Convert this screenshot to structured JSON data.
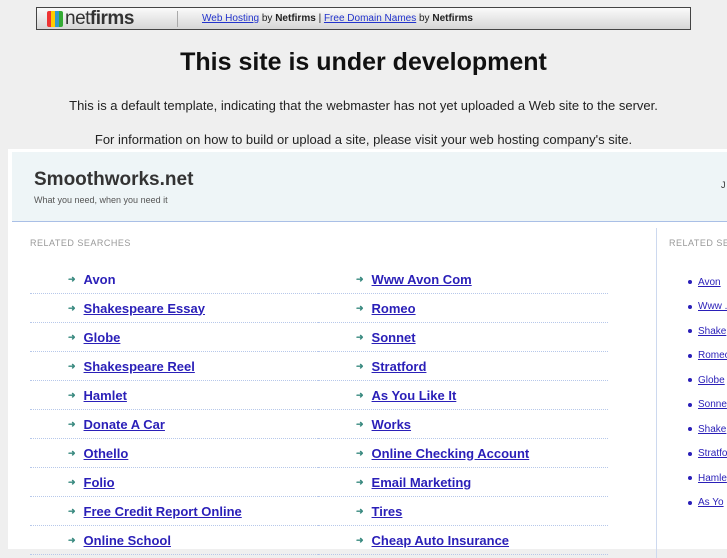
{
  "topbar": {
    "logo_text_light": "net",
    "logo_text_bold": "firms",
    "link1": "Web Hosting",
    "by1": "by",
    "brand1": "Netfirms",
    "pipe": "|",
    "link2": "Free Domain Names",
    "by2": "by",
    "brand2": "Netfirms"
  },
  "title": "This site is under development",
  "para1": "This is a default template, indicating that the webmaster has not yet uploaded a Web site to the server.",
  "para2": "For information on how to build or upload a site, please visit your web hosting company's site.",
  "site": {
    "name": "Smoothworks.net",
    "tagline": "What you need, when you need it",
    "right_char": "J"
  },
  "related_label": "RELATED SEARCHES",
  "side_label": "RELATED SEA",
  "left_col": [
    "Avon",
    "Shakespeare Essay",
    "Globe",
    "Shakespeare Reel",
    "Hamlet",
    "Donate A Car",
    "Othello",
    "Folio",
    "Free Credit Report Online",
    "Online School"
  ],
  "right_col": [
    "Www Avon Com",
    "Romeo",
    "Sonnet",
    "Stratford",
    "As You Like It",
    "Works",
    "Online Checking Account",
    "Email Marketing",
    "Tires",
    "Cheap Auto Insurance"
  ],
  "sidebar": [
    "Avon",
    "Www .",
    "Shake",
    "Romeo",
    "Globe",
    "Sonne",
    "Shake",
    "Stratfo",
    "Hamle",
    "As Yo"
  ]
}
